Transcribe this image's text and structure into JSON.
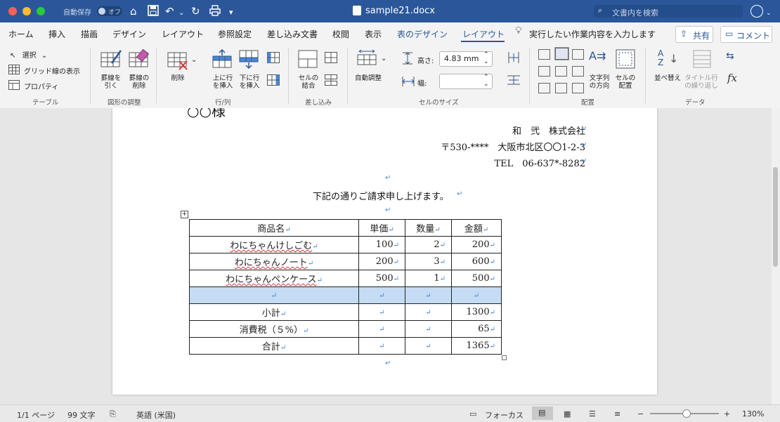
{
  "window": {
    "title": "sample21.docx",
    "autosave_label": "自動保存",
    "autosave_state": "オフ",
    "search_placeholder": "文書内を検索"
  },
  "ribbon_tabs": [
    "ホーム",
    "挿入",
    "描画",
    "デザイン",
    "レイアウト",
    "参照設定",
    "差し込み文書",
    "校閲",
    "表示",
    "表のデザイン",
    "レイアウト"
  ],
  "tell_me": "実行したい作業内容を入力します",
  "share_label": "共有",
  "comment_label": "コメント",
  "ribbon": {
    "table_group": {
      "label": "テーブル",
      "select": "選択",
      "gridlines": "グリッド線の表示",
      "properties": "プロパティ"
    },
    "draw_group": {
      "label": "図形の調整",
      "draw_table": "罫線を\n引く",
      "eraser": "罫線の\n削除"
    },
    "rows_cols_group": {
      "label": "行/列",
      "delete": "削除",
      "insert_above": "上に行\nを挿入",
      "insert_below": "下に行\nを挿入"
    },
    "merge_group": {
      "label": "差し込み",
      "merge_cells": "セルの\n結合"
    },
    "cell_size_group": {
      "label": "セルのサイズ",
      "autofit": "自動調整",
      "height_label": "高さ:",
      "height_value": "4.83 mm",
      "width_label": "幅:",
      "width_value": ""
    },
    "alignment_group": {
      "label": "配置",
      "text_direction": "文字列\nの方向",
      "cell_margins": "セルの\n配置"
    },
    "data_group": {
      "label": "データ",
      "sort": "並べ替え",
      "repeat_header": "タイトル行\nの繰り返し",
      "formula_icon": "fx"
    }
  },
  "document": {
    "heading_fragment": "○○様",
    "company": "和　弐　株式会社",
    "address": "〒530-****　大阪市北区〇〇1-2-3",
    "tel": "TEL　06-637*-8282",
    "intro": "下記の通りご請求申し上げます。",
    "paragraph_mark": "↵",
    "table": {
      "headers": [
        "商品名",
        "単価",
        "数量",
        "金額"
      ],
      "rows": [
        [
          "わにちゃんけしごむ",
          "100",
          "2",
          "200"
        ],
        [
          "わにちゃんノート",
          "200",
          "3",
          "600"
        ],
        [
          "わにちゃんペンケース",
          "500",
          "1",
          "500"
        ],
        [
          "",
          "",
          "",
          ""
        ],
        [
          "小計",
          "",
          "",
          "1300"
        ],
        [
          "消費税（５%）",
          "",
          "",
          "65"
        ],
        [
          "合計",
          "",
          "",
          "1365"
        ]
      ]
    }
  },
  "statusbar": {
    "page": "1/1 ページ",
    "words": "99 文字",
    "language": "英語 (米国)",
    "focus": "フォーカス",
    "zoom": "130%"
  },
  "colors": {
    "titlebar": "#2b579a",
    "accent": "#2b579a",
    "selection": "#c4dcf4",
    "paragraph_mark": "#4a86d8"
  }
}
